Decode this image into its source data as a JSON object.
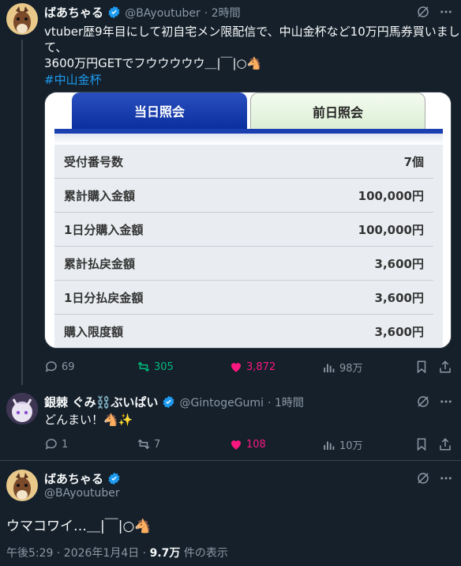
{
  "post1": {
    "name": "ばあちゃる",
    "handle": "@BAyoutuber",
    "time": "· 2時間",
    "text_line1": "vtuber歴9年目にして初自宅メン限配信で、中山金杯など10万円馬券買いまし",
    "text_line2": "て、",
    "text_line3": "3600万円GETでフウウウウウ＿|￣|○🐴",
    "hashtag": "#中山金杯",
    "card": {
      "tab_today": "当日照会",
      "tab_prev": "前日照会",
      "rows": [
        {
          "label": "受付番号数",
          "value": "7個"
        },
        {
          "label": "累計購入金額",
          "value": "100,000円"
        },
        {
          "label": "1日分購入金額",
          "value": "100,000円"
        },
        {
          "label": "累計払戻金額",
          "value": "3,600円"
        },
        {
          "label": "1日分払戻金額",
          "value": "3,600円"
        },
        {
          "label": "購入限度額",
          "value": "3,600円"
        }
      ]
    },
    "replies": "69",
    "reposts": "305",
    "likes": "3,872",
    "views": "98万"
  },
  "post2": {
    "name": "銀棘 ぐみ⛓️ぶいぱい",
    "handle": "@GintogeGumi",
    "time": "· 1時間",
    "text": "どんまい！🐴✨",
    "replies": "1",
    "reposts": "7",
    "likes": "108",
    "views": "10万"
  },
  "post3": {
    "name": "ばあちゃる",
    "handle": "@BAyoutuber",
    "text": "ウマコワイ…＿|￣|○🐴",
    "timestamp": "午後5:29 · 2026年1月4日 · ",
    "view_count": "9.7万",
    "view_suffix": " 件の表示"
  },
  "colors": {
    "background": "#15202b",
    "accent": "#1d9bf0",
    "repost_active": "#00ba7c",
    "like_active": "#f91880",
    "muted": "#8b98a5"
  }
}
